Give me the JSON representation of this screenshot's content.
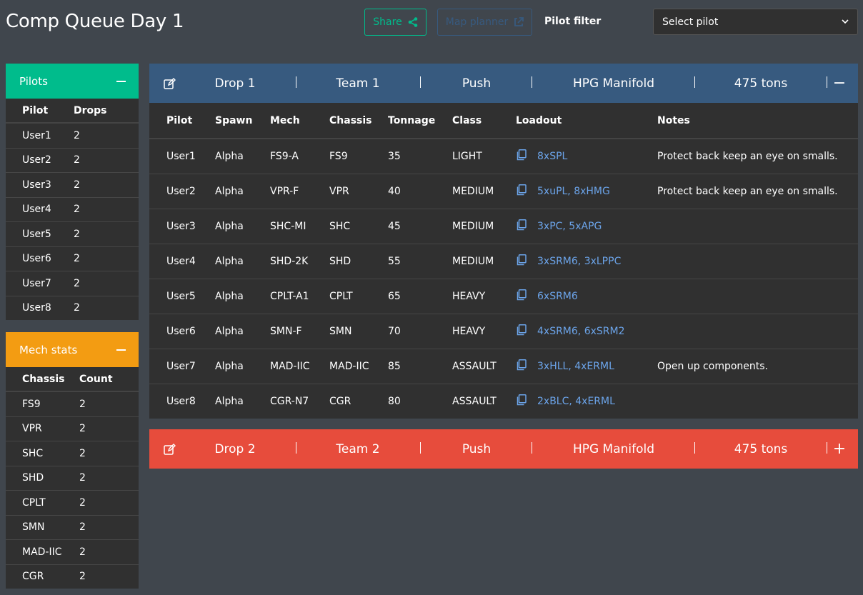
{
  "header": {
    "title": "Comp Queue Day 1",
    "share_label": "Share",
    "map_planner_label": "Map planner",
    "pilot_filter_label": "Pilot filter",
    "select_placeholder": "Select pilot"
  },
  "pilots_card": {
    "title": "Pilots",
    "columns": [
      "Pilot",
      "Drops"
    ],
    "rows": [
      [
        "User1",
        "2"
      ],
      [
        "User2",
        "2"
      ],
      [
        "User3",
        "2"
      ],
      [
        "User4",
        "2"
      ],
      [
        "User5",
        "2"
      ],
      [
        "User6",
        "2"
      ],
      [
        "User7",
        "2"
      ],
      [
        "User8",
        "2"
      ]
    ]
  },
  "mech_card": {
    "title": "Mech stats",
    "columns": [
      "Chassis",
      "Count"
    ],
    "rows": [
      [
        "FS9",
        "2"
      ],
      [
        "VPR",
        "2"
      ],
      [
        "SHC",
        "2"
      ],
      [
        "SHD",
        "2"
      ],
      [
        "CPLT",
        "2"
      ],
      [
        "SMN",
        "2"
      ],
      [
        "MAD-IIC",
        "2"
      ],
      [
        "CGR",
        "2"
      ]
    ]
  },
  "drops": [
    {
      "name": "Drop 1",
      "team": "Team 1",
      "mode": "Push",
      "map": "HPG Manifold",
      "tonnage": "475 tons",
      "toggle": "−",
      "color": "#375a7f",
      "columns": [
        "Pilot",
        "Spawn",
        "Mech",
        "Chassis",
        "Tonnage",
        "Class",
        "Loadout",
        "Notes"
      ],
      "rows": [
        {
          "pilot": "User1",
          "spawn": "Alpha",
          "mech": "FS9-A",
          "chassis": "FS9",
          "tonnage": "35",
          "class": "LIGHT",
          "loadout": "8xSPL",
          "notes": "Protect back keep an eye on smalls."
        },
        {
          "pilot": "User2",
          "spawn": "Alpha",
          "mech": "VPR-F",
          "chassis": "VPR",
          "tonnage": "40",
          "class": "MEDIUM",
          "loadout": "5xuPL, 8xHMG",
          "notes": "Protect back keep an eye on smalls."
        },
        {
          "pilot": "User3",
          "spawn": "Alpha",
          "mech": "SHC-MI",
          "chassis": "SHC",
          "tonnage": "45",
          "class": "MEDIUM",
          "loadout": "3xPC, 5xAPG",
          "notes": ""
        },
        {
          "pilot": "User4",
          "spawn": "Alpha",
          "mech": "SHD-2K",
          "chassis": "SHD",
          "tonnage": "55",
          "class": "MEDIUM",
          "loadout": "3xSRM6, 3xLPPC",
          "notes": ""
        },
        {
          "pilot": "User5",
          "spawn": "Alpha",
          "mech": "CPLT-A1",
          "chassis": "CPLT",
          "tonnage": "65",
          "class": "HEAVY",
          "loadout": "6xSRM6",
          "notes": ""
        },
        {
          "pilot": "User6",
          "spawn": "Alpha",
          "mech": "SMN-F",
          "chassis": "SMN",
          "tonnage": "70",
          "class": "HEAVY",
          "loadout": "4xSRM6, 6xSRM2",
          "notes": ""
        },
        {
          "pilot": "User7",
          "spawn": "Alpha",
          "mech": "MAD-IIC",
          "chassis": "MAD-IIC",
          "tonnage": "85",
          "class": "ASSAULT",
          "loadout": "3xHLL, 4xERML",
          "notes": "Open up components."
        },
        {
          "pilot": "User8",
          "spawn": "Alpha",
          "mech": "CGR-N7",
          "chassis": "CGR",
          "tonnage": "80",
          "class": "ASSAULT",
          "loadout": "2xBLC, 4xERML",
          "notes": ""
        }
      ]
    },
    {
      "name": "Drop 2",
      "team": "Team 2",
      "mode": "Push",
      "map": "HPG Manifold",
      "tonnage": "475 tons",
      "toggle": "+",
      "color": "#e74c3c"
    }
  ],
  "icons": [
    "share-icon",
    "external-link-icon",
    "chevron-down-icon",
    "minus-icon",
    "edit-icon",
    "copy-icon",
    "plus-icon"
  ]
}
